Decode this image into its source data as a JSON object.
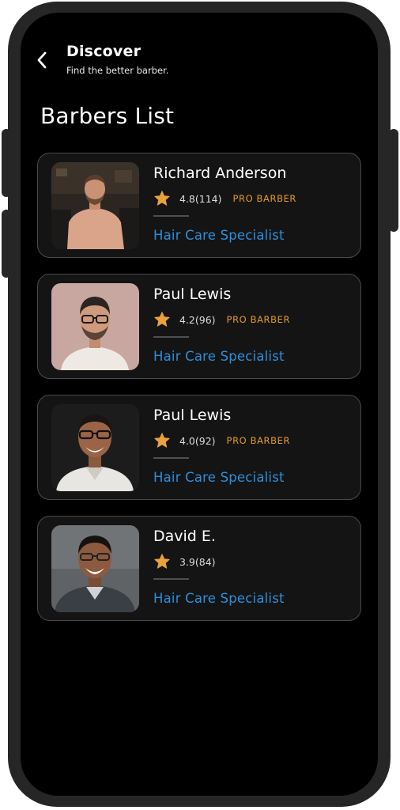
{
  "header": {
    "title": "Discover",
    "subtitle": "Find the better barber.",
    "back_icon": "chevron-left-icon"
  },
  "page_title": "Barbers List",
  "colors": {
    "background": "#000000",
    "card_background": "#141414",
    "card_border": "#4a4a4a",
    "star": "#e9a23b",
    "badge": "#e39a2e",
    "specialty": "#2f8fdc"
  },
  "barbers": [
    {
      "name": "Richard Anderson",
      "rating": "4.8(114)",
      "badge": "PRO BARBER",
      "specialty": "Hair Care Specialist",
      "star_icon": "star-icon"
    },
    {
      "name": "Paul Lewis",
      "rating": "4.2(96)",
      "badge": "PRO BARBER",
      "specialty": "Hair Care Specialist",
      "star_icon": "star-icon"
    },
    {
      "name": "Paul Lewis",
      "rating": "4.0(92)",
      "badge": "PRO BARBER",
      "specialty": "Hair Care Specialist",
      "star_icon": "star-icon"
    },
    {
      "name": "David E.",
      "rating": "3.9(84)",
      "badge": "",
      "specialty": "Hair Care Specialist",
      "star_icon": "star-icon"
    }
  ]
}
